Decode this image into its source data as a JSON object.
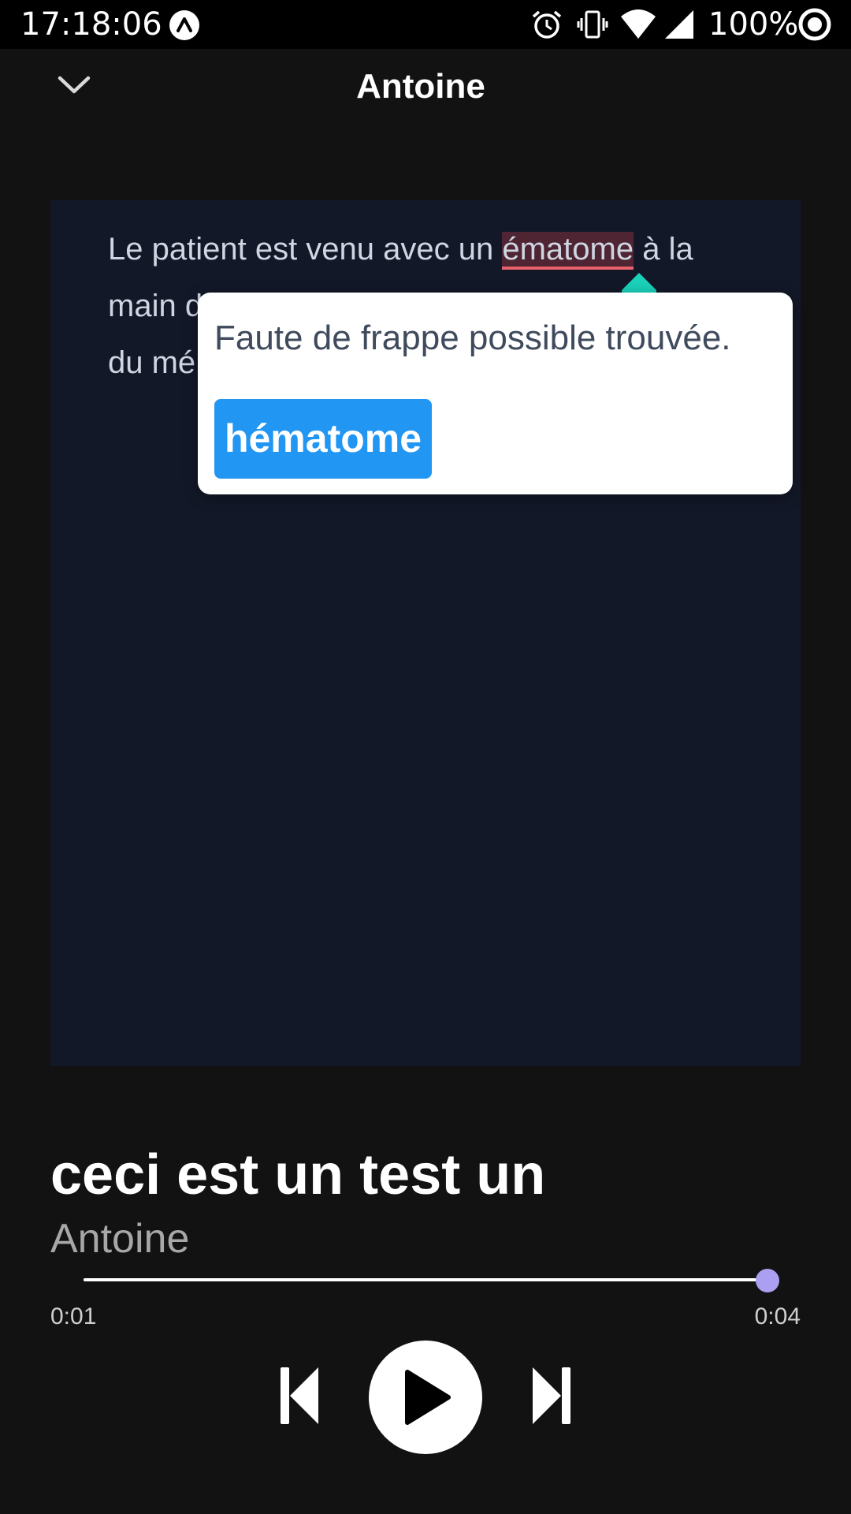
{
  "status_bar": {
    "time": "17:18:06",
    "battery": "100%",
    "icons": [
      "app-a-icon",
      "alarm-icon",
      "vibrate-icon",
      "wifi-icon",
      "signal-icon",
      "circle-status-icon"
    ]
  },
  "header": {
    "title": "Antoine",
    "back_icon": "chevron-down-icon"
  },
  "editor": {
    "line1_before": "Le patient est venu avec un ",
    "typo_word": "ématome",
    "line1_after": " à la",
    "line2_start": "main d",
    "line3_start": "du mé"
  },
  "popup": {
    "message": "Faute de frappe possible trouvée.",
    "suggestion": "hématome"
  },
  "track": {
    "title": "ceci est un test un",
    "artist": "Antoine"
  },
  "player": {
    "current_time": "0:01",
    "total_time": "0:04",
    "progress_fraction": 1.0
  },
  "colors": {
    "accent_blue": "#2196f3",
    "thumb_purple": "#ab9ff2",
    "typo_underline": "#e8626c",
    "cursor_teal": "#1ad1b9",
    "editor_bg": "#131828"
  }
}
